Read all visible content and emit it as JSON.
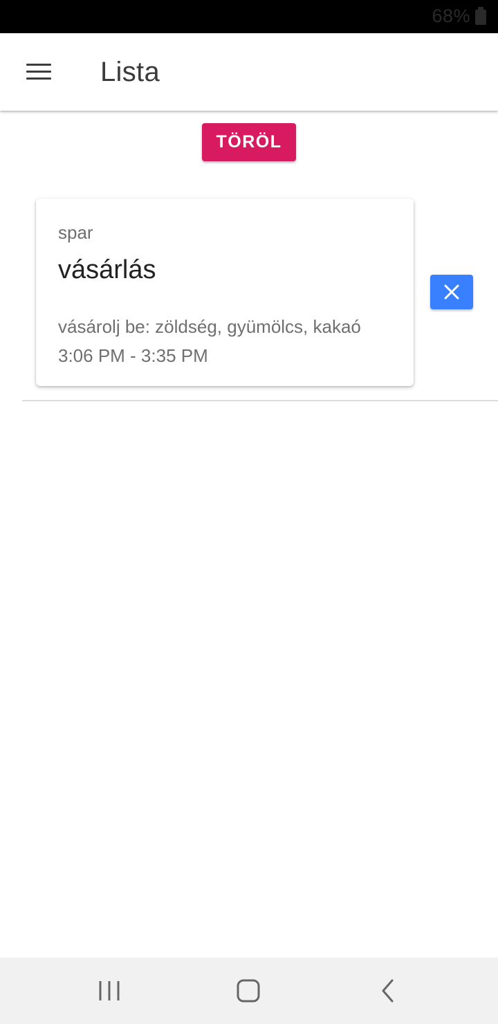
{
  "status_bar": {
    "battery_text": "68%",
    "icons": [
      "battery-icon"
    ]
  },
  "toolbar": {
    "title": "Lista",
    "menu_icon": "menu-icon"
  },
  "actions": {
    "delete_all_label": "TÖRÖL",
    "delete_all_color": "#d81b60"
  },
  "list": {
    "items": [
      {
        "subtitle": "spar",
        "title": "vásárlás",
        "description": "vásárolj be: zöldség, gyümölcs, kakaó",
        "time": "3:06 PM - 3:35 PM",
        "remove_icon": "close-icon",
        "remove_color": "#3880ff"
      }
    ]
  },
  "nav_bar": {
    "buttons": [
      "recents-icon",
      "home-icon",
      "back-icon"
    ]
  }
}
